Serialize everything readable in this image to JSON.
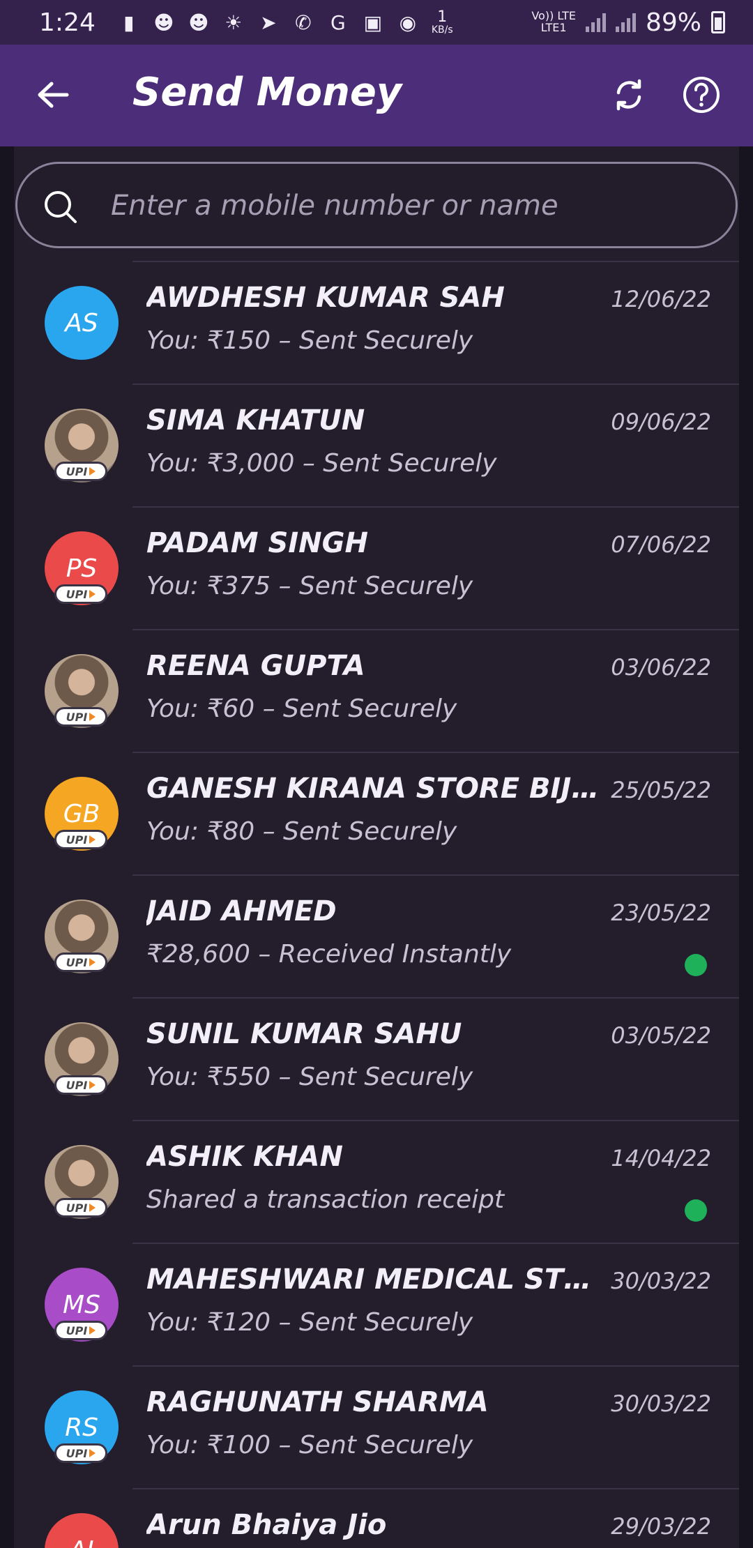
{
  "status_bar": {
    "time": "1:24",
    "speed_value": "1",
    "speed_unit": "KB/s",
    "network_top": "Vo)) LTE",
    "network_bottom": "LTE1",
    "battery": "89%"
  },
  "header": {
    "title": "Send Money"
  },
  "search": {
    "placeholder": "Enter a mobile number or name"
  },
  "colors": {
    "app_bar": "#4b2d7a",
    "background": "#231d2c",
    "status_dot": "#1fb05a"
  },
  "contacts": [
    {
      "name": "AWDHESH KUMAR SAH",
      "subtitle": "You: ₹150 – Sent Securely",
      "date": "12/06/22",
      "initials": "AS",
      "avatar_color": "#2aa6ef",
      "upi": false,
      "dot": false
    },
    {
      "name": "SIMA  KHATUN",
      "subtitle": "You: ₹3,000 – Sent Securely",
      "date": "09/06/22",
      "initials": "",
      "avatar_color": "photo",
      "upi": true,
      "dot": false
    },
    {
      "name": "PADAM SINGH",
      "subtitle": "You: ₹375 – Sent Securely",
      "date": "07/06/22",
      "initials": "PS",
      "avatar_color": "#ea4a4a",
      "upi": true,
      "dot": false
    },
    {
      "name": "REENA GUPTA",
      "subtitle": "You: ₹60 – Sent Securely",
      "date": "03/06/22",
      "initials": "",
      "avatar_color": "photo",
      "upi": true,
      "dot": false
    },
    {
      "name": "GANESH KIRANA STORE BIJ...",
      "subtitle": "You: ₹80 – Sent Securely",
      "date": "25/05/22",
      "initials": "GB",
      "avatar_color": "#f5a623",
      "upi": true,
      "dot": false
    },
    {
      "name": "JAID AHMED",
      "subtitle": "₹28,600 – Received Instantly",
      "date": "23/05/22",
      "initials": "",
      "avatar_color": "photo",
      "upi": true,
      "dot": true
    },
    {
      "name": "SUNIL KUMAR SAHU",
      "subtitle": "You: ₹550 – Sent Securely",
      "date": "03/05/22",
      "initials": "",
      "avatar_color": "photo",
      "upi": true,
      "dot": false
    },
    {
      "name": "ASHIK  KHAN",
      "subtitle": "Shared a transaction receipt",
      "date": "14/04/22",
      "initials": "",
      "avatar_color": "photo",
      "upi": true,
      "dot": true
    },
    {
      "name": "MAHESHWARI MEDICAL STO...",
      "subtitle": "You: ₹120 – Sent Securely",
      "date": "30/03/22",
      "initials": "MS",
      "avatar_color": "#a84dc7",
      "upi": true,
      "dot": false
    },
    {
      "name": "RAGHUNATH SHARMA",
      "subtitle": "You: ₹100 – Sent Securely",
      "date": "30/03/22",
      "initials": "RS",
      "avatar_color": "#2aa6ef",
      "upi": true,
      "dot": false
    },
    {
      "name": "Arun Bhaiya Jio",
      "subtitle": "",
      "date": "29/03/22",
      "initials": "AJ",
      "avatar_color": "#ea4a4a",
      "upi": false,
      "dot": false
    }
  ],
  "upi_label": "UPI"
}
